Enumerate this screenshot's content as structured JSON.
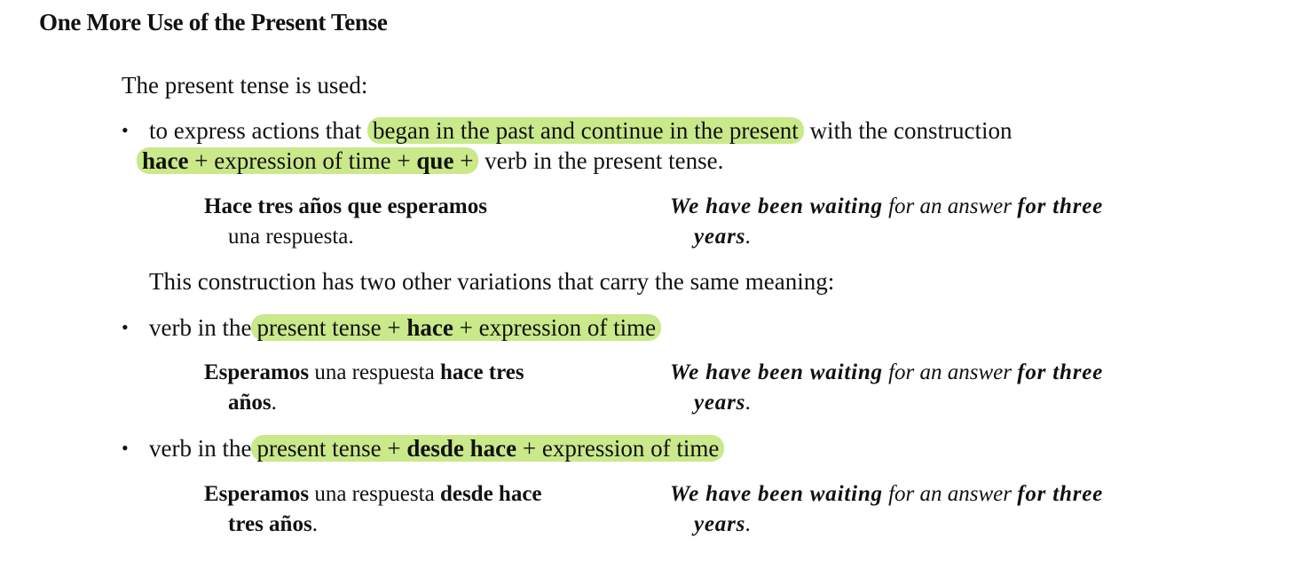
{
  "title": "One More Use of the Present Tense",
  "intro": "The present tense is used:",
  "bullet_char": "•",
  "b1": {
    "t1": "to express actions that",
    "hl": "began in the past and continue in the present",
    "t2": "with the construction",
    "hace": "hace",
    "mid": "+ expression of time +",
    "que": "que",
    "plus": "+",
    "tail": "verb in the present tense."
  },
  "ex1": {
    "es_line1": "Hace tres años que esperamos",
    "es_line2": "una respuesta.",
    "en_bi1": "We have been waiting",
    "en_it": "for an answer",
    "en_bi2": "for three",
    "en_bi3": "years",
    "en_dot": "."
  },
  "variations": "This construction has two other variations that carry the same meaning:",
  "b2": {
    "t1": "verb in the",
    "h1": "present tense",
    "plus1": "+",
    "bold": "hace",
    "tail": "+ expression of time"
  },
  "ex2": {
    "es_b1": "Esperamos",
    "es_n1": "una respuesta",
    "es_b2": "hace tres",
    "es_b3": "años",
    "es_dot": ".",
    "en_bi1": "We have been waiting",
    "en_it": "for an answer",
    "en_bi2": "for three",
    "en_bi3": "years",
    "en_dot": "."
  },
  "b3": {
    "t1": "verb in the",
    "h1": "present tense",
    "plus1": "+",
    "bold": "desde hace",
    "tail": "+ expression of time"
  },
  "ex3": {
    "es_b1": "Esperamos",
    "es_n1": "una respuesta",
    "es_b2": "desde hace",
    "es_b3": "tres años",
    "es_dot": ".",
    "en_bi1": "We have been waiting",
    "en_it": "for an answer",
    "en_bi2": "for three",
    "en_bi3": "years",
    "en_dot": "."
  }
}
